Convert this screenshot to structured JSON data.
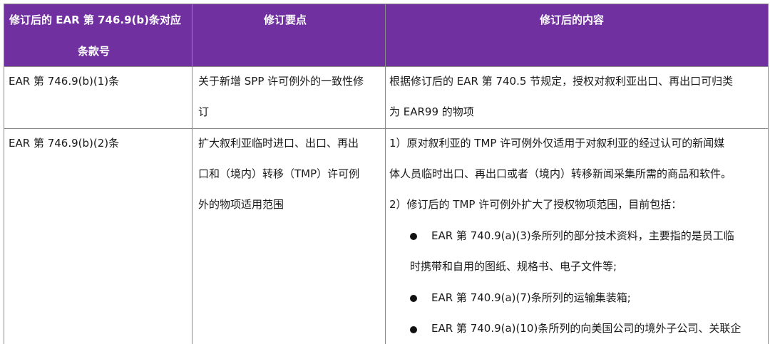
{
  "table": {
    "headers": {
      "col1_line1": "修订后的 EAR 第 746.9(b)条对应",
      "col1_line2": "条款号",
      "col2": "修订要点",
      "col3": "修订后的内容"
    },
    "row1": {
      "ref": "EAR 第 746.9(b)(1)条",
      "point_line1": "关于新增 SPP 许可例外的一致性修",
      "point_line2": "订",
      "content_line1": "根据修订后的 EAR 第 740.5 节规定，授权对叙利亚出口、再出口可归类",
      "content_line2": "为 EAR99 的物项"
    },
    "row2": {
      "ref": "EAR 第 746.9(b)(2)条",
      "point_line1": "扩大叙利亚临时进口、出口、再出",
      "point_line2": "口和（境内）转移（TMP）许可例",
      "point_line3": "外的物项适用范围",
      "c1": "1）原对叙利亚的 TMP 许可例外仅适用于对叙利亚的经过认可的新闻媒",
      "c2": "体人员临时出口、再出口或者（境内）转移新闻采集所需的商品和软件。",
      "c3": "2）修订后的 TMP 许可例外扩大了授权物项范围，目前包括：",
      "b1_line1": "EAR 第 740.9(a)(3)条所列的部分技术资料，主要指的是员工临",
      "b1_line2": "时携带和自用的图纸、规格书、电子文件等;",
      "b2": "EAR 第 740.9(a)(7)条所列的运输集装箱;",
      "b3": "EAR 第 740.9(a)(10)条所列的向美国公司的境外子公司、关联企"
    }
  },
  "colors": {
    "header_bg": "#7030a0",
    "header_text": "#ffffff",
    "border": "#8a8a8a"
  }
}
